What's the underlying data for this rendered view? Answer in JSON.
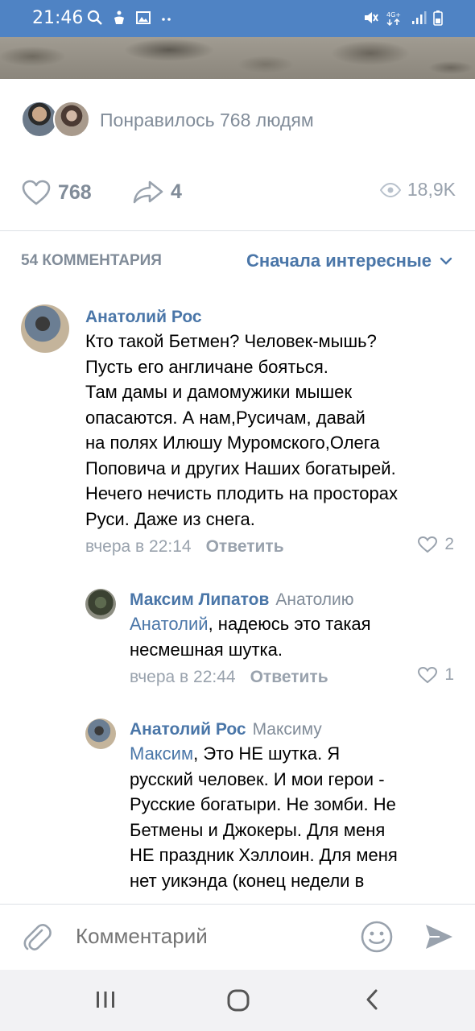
{
  "status_bar": {
    "time": "21:46",
    "left_icons": [
      "search-icon",
      "accessibility-icon",
      "image-icon",
      "more-dots-icon"
    ],
    "right_icons": [
      "mute-icon",
      "network-4g-icon",
      "signal-icon",
      "battery-icon"
    ],
    "network_label": "4G+"
  },
  "post": {
    "likes_text": "Понравилось 768 людям",
    "like_count": "768",
    "share_count": "4",
    "views": "18,9K"
  },
  "comments_header": {
    "count_label": "54 КОММЕНТАРИЯ",
    "sort_label": "Сначала интересные"
  },
  "comments": [
    {
      "author": "Анатолий Рос",
      "reply_to": "",
      "mention": "",
      "lines": [
        "Кто такой Бетмен? Человек-мышь?",
        "Пусть его англичане бояться.",
        "Там дамы и дамомужики мышек",
        "опасаются. А нам,Русичам, давай",
        "на полях Илюшу Муромского,Олега",
        "Поповича и других Наших богатырей.",
        "Нечего нечисть плодить на просторах",
        "Руси. Даже из снега."
      ],
      "time": "вчера в 22:14",
      "reply_label": "Ответить",
      "likes": "2"
    },
    {
      "author": "Максим Липатов",
      "reply_to": "Анатолию",
      "mention": "Анатолий",
      "first_line_rest": ", надеюсь это такая",
      "lines": [
        "несмешная шутка."
      ],
      "time": "вчера в 22:44",
      "reply_label": "Ответить",
      "likes": "1"
    },
    {
      "author": "Анатолий Рос",
      "reply_to": "Максиму",
      "mention": "Максим",
      "first_line_rest": ", Это НЕ шутка. Я",
      "lines": [
        "русский человек. И мои герои -",
        "Русские богатыри. Не зомби. Не",
        "Бетмены и Джокеры. Для меня",
        "НЕ праздник Хэллоин. Для меня",
        "нет уикэнда (конец недели в"
      ]
    }
  ],
  "composer": {
    "placeholder": "Комментарий"
  },
  "nav_bar": {
    "buttons": [
      "recent-apps-icon",
      "home-icon",
      "back-icon"
    ]
  },
  "colors": {
    "link": "#4a76a8",
    "secondary": "#818c99",
    "status_bar": "#4f83c4"
  }
}
